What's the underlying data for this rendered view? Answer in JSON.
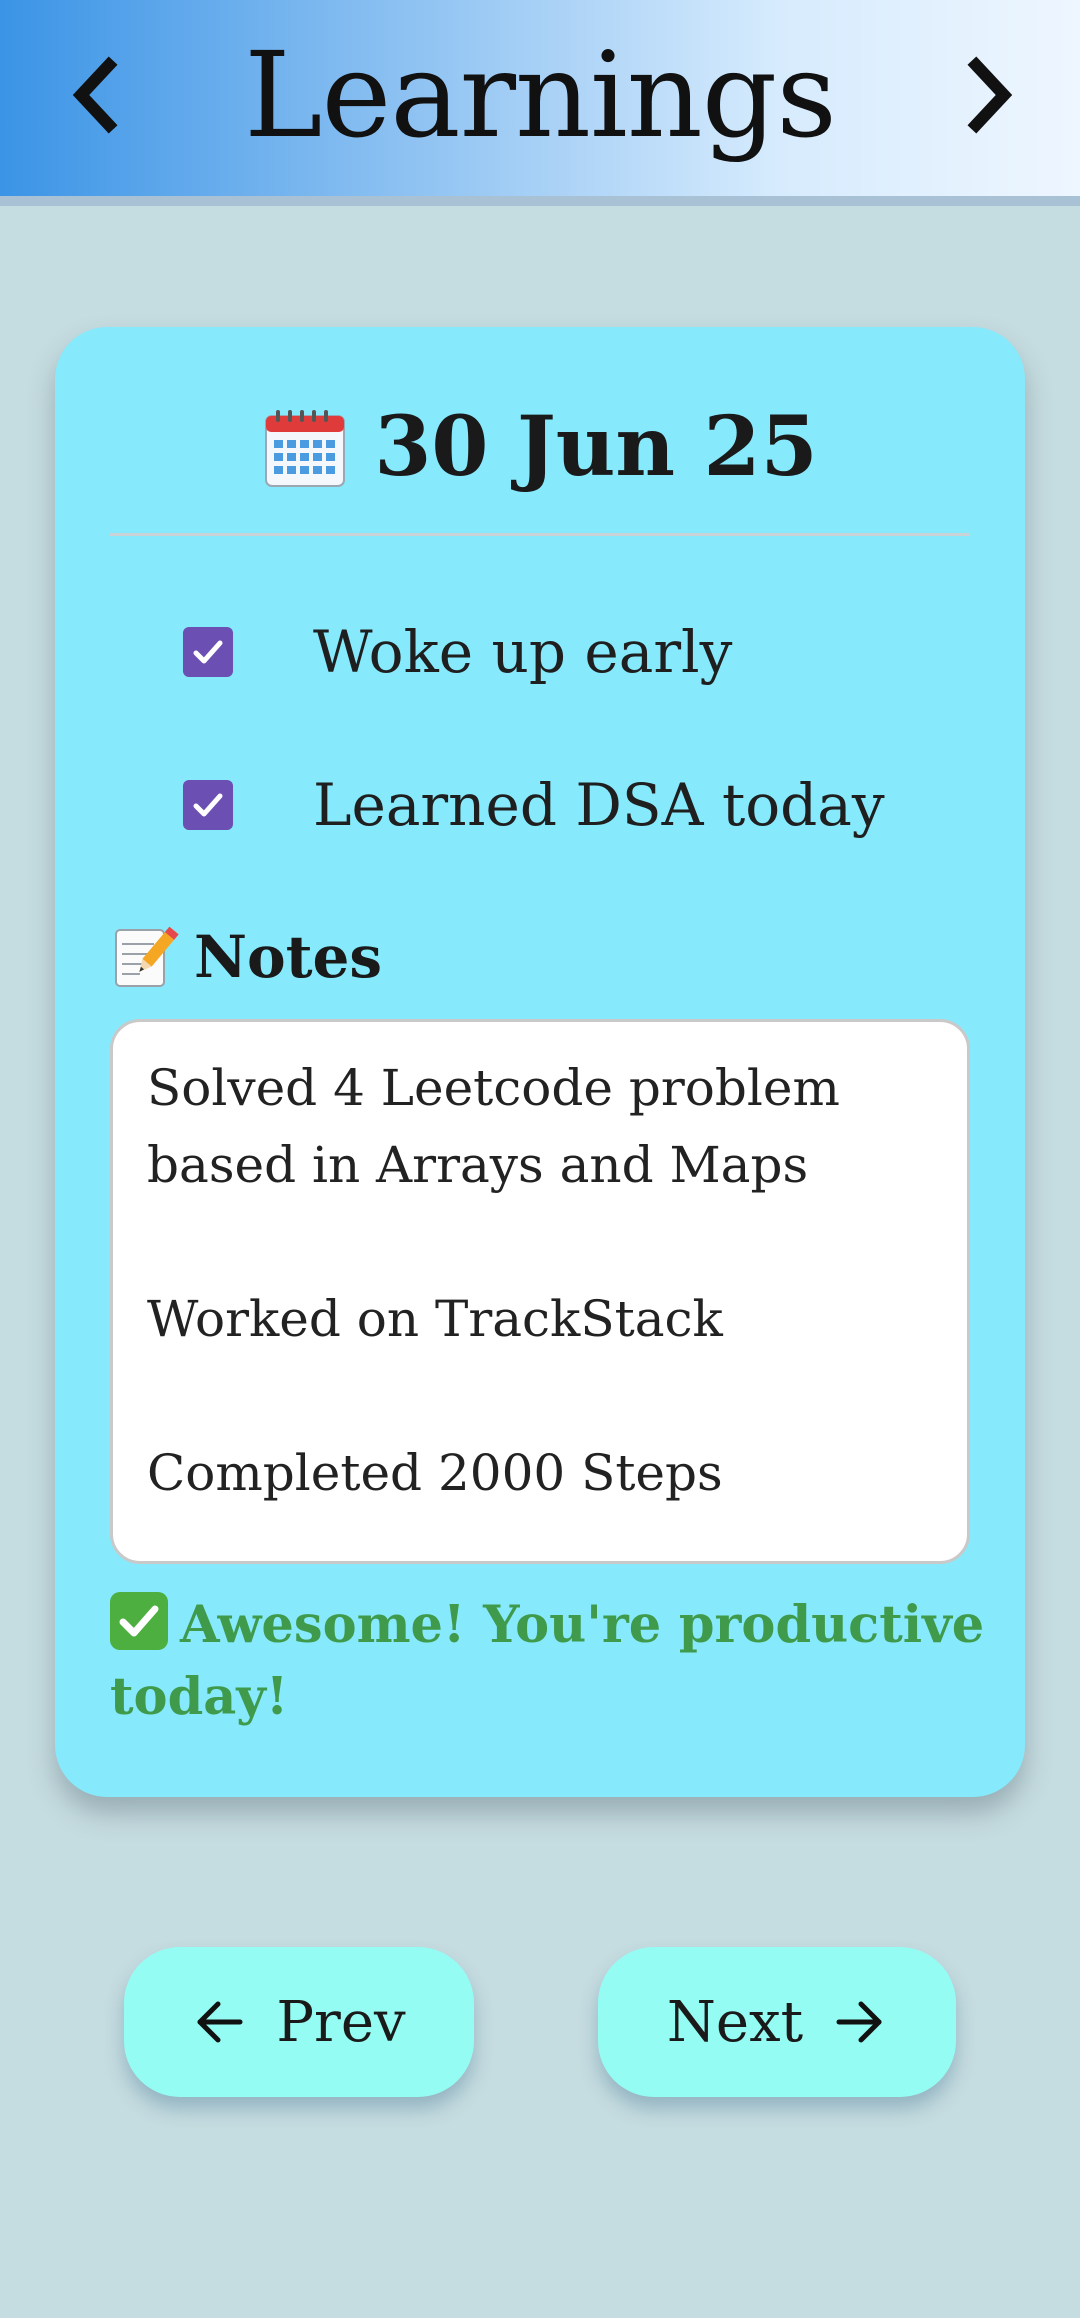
{
  "header": {
    "title": "Learnings",
    "back_icon": "chevron-left-icon",
    "forward_icon": "chevron-right-icon"
  },
  "card": {
    "date_icon": "calendar-icon",
    "date": "30 Jun 25",
    "checklist": [
      {
        "label": "Woke up early",
        "checked": true
      },
      {
        "label": "Learned DSA today",
        "checked": true
      }
    ],
    "notes_icon": "memo-icon",
    "notes_title": "Notes",
    "notes_text": "Solved 4 Leetcode problem\nbased in Arrays and Maps\n\nWorked on TrackStack\n\nCompleted 2000 Steps",
    "status_icon": "check-mark-icon",
    "status_text": "Awesome! You're productive today!"
  },
  "footer": {
    "prev_label": "Prev",
    "next_label": "Next"
  },
  "colors": {
    "card_bg": "#86e9fc",
    "page_bg": "#c5dce0",
    "checkbox": "#6c4fb3",
    "status_text": "#3f9a4b",
    "button_bg": "#95fcf3"
  }
}
